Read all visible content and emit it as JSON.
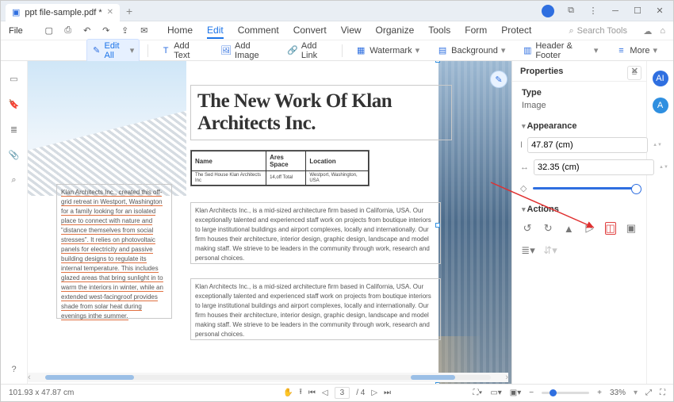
{
  "titlebar": {
    "tab_title": "ppt file-sample.pdf *"
  },
  "menu": {
    "file": "File"
  },
  "ribbon": {
    "home": "Home",
    "edit": "Edit",
    "comment": "Comment",
    "convert": "Convert",
    "view": "View",
    "organize": "Organize",
    "tools": "Tools",
    "form": "Form",
    "protect": "Protect",
    "search_placeholder": "Search Tools"
  },
  "toolbar": {
    "edit_all": "Edit All",
    "add_text": "Add Text",
    "add_image": "Add Image",
    "add_link": "Add Link",
    "watermark": "Watermark",
    "background": "Background",
    "header_footer": "Header & Footer",
    "more": "More"
  },
  "doc": {
    "headline": "The New Work Of Klan Architects Inc.",
    "table": {
      "h1": "Name",
      "h2": "Ares Space",
      "h3": "Location",
      "c1": "The Sed House Klan Architects Inc",
      "c2": "14,off Total",
      "c3": "Westport, Washington, USA"
    },
    "col1": "Klan Architects Inc., created this off-grid retreat in Westport, Washington for a family looking for an isolated place to connect with nature and \"distance themselves from social stresses\". It relies on photovoltaic panels for electricity and passive building designs to regulate its internal temperature. This includes glazed areas that bring sunlight in to warm the interiors in winter, while an extended west-facingroof provides shade from solar heat during evenings inthe summer.",
    "col2": "Klan Architects Inc., is a mid-sized architecture firm based in California, USA. Our exceptionally talented and experienced staff work on projects from boutique interiors to large institutional buildings and airport complexes, locally and internationally. Our firm houses their architecture, interior design, graphic design, landscape and model making staff. We strieve to be leaders in the community through work, research and personal choices.",
    "col3": "Klan Architects Inc., is a mid-sized architecture firm based in California, USA. Our exceptionally talented and experienced staff work on projects from boutique interiors to large institutional buildings and airport complexes, locally and internationally. Our firm houses their architecture, interior design, graphic design, landscape and model making staff. We strieve to be leaders in the community through work, research and personal choices."
  },
  "props": {
    "title": "Properties",
    "type_label": "Type",
    "type_value": "Image",
    "appearance": "Appearance",
    "width": "47.87 (cm)",
    "height": "32.35 (cm)",
    "actions": "Actions"
  },
  "status": {
    "coords": "101.93 x 47.87 cm",
    "page_input": "3",
    "page_total": "/ 4",
    "zoom": "33%"
  }
}
